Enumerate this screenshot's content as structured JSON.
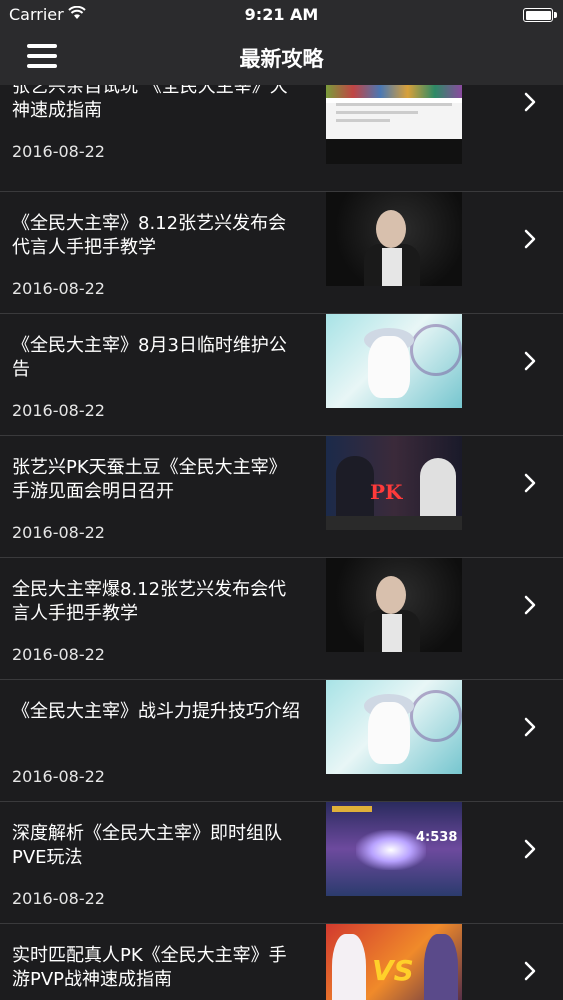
{
  "status_bar": {
    "carrier": "Carrier",
    "time": "9:21 AM"
  },
  "nav": {
    "title": "最新攻略",
    "menu_icon": "hamburger-menu-icon"
  },
  "articles": [
    {
      "title": "张艺兴亲自试玩 《全民大主宰》大神速成指南",
      "date": "2016-08-22"
    },
    {
      "title": "《全民大主宰》8.12张艺兴发布会 代言人手把手教学",
      "date": "2016-08-22"
    },
    {
      "title": "《全民大主宰》8月3日临时维护公告",
      "date": "2016-08-22"
    },
    {
      "title": "张艺兴PK天蚕土豆《全民大主宰》手游见面会明日召开",
      "date": "2016-08-22"
    },
    {
      "title": "全民大主宰爆8.12张艺兴发布会代言人手把手教学",
      "date": "2016-08-22"
    },
    {
      "title": "《全民大主宰》战斗力提升技巧介绍",
      "date": "2016-08-22"
    },
    {
      "title": "深度解析《全民大主宰》即时组队PVE玩法",
      "date": "2016-08-22"
    },
    {
      "title": "实时匹配真人PK《全民大主宰》手游PVP战神速成指南",
      "date": ""
    }
  ],
  "thumb_overlay": {
    "pk_text": "PK",
    "score": "4:538",
    "vs_text": "VS"
  },
  "colors": {
    "background": "#1c1c1e",
    "bar": "#2b2b2d",
    "separator": "#3a3a3c"
  }
}
